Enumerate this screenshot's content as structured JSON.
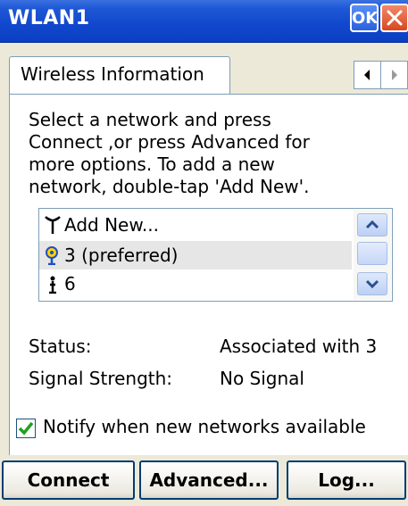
{
  "window": {
    "title": "WLAN1",
    "ok_label": "OK"
  },
  "tabs": [
    {
      "label": "Wireless Information"
    }
  ],
  "instructions": [
    "Select a network and press",
    "Connect ,or press Advanced for",
    "more options. To add a new",
    "network, double-tap 'Add New'."
  ],
  "networks": [
    {
      "label": "Add New...",
      "icon": "antenna-icon",
      "selected": false
    },
    {
      "label": "3 (preferred)",
      "icon": "preferred-network-icon",
      "selected": true
    },
    {
      "label": "6",
      "icon": "network-icon",
      "selected": false
    }
  ],
  "status": {
    "status_label": "Status:",
    "status_value": "Associated with 3",
    "signal_label": "Signal Strength:",
    "signal_value": "No Signal"
  },
  "notify": {
    "label": "Notify when new networks available",
    "checked": true
  },
  "buttons": {
    "connect": "Connect",
    "advanced": "Advanced...",
    "log": "Log..."
  },
  "colors": {
    "titlebar": "#1147cd",
    "face": "#ece9d8",
    "check": "#21a121",
    "selection": "#e6e6e6"
  }
}
